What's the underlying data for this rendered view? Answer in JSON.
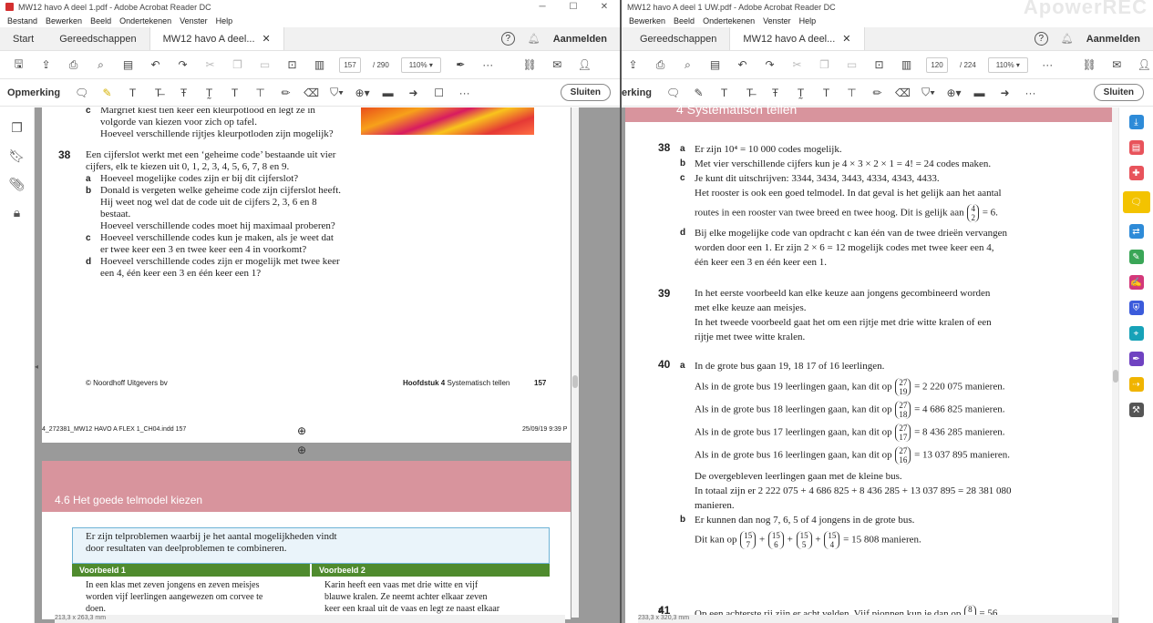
{
  "left": {
    "title": "MW12 havo A deel 1.pdf - Adobe Acrobat Reader DC",
    "menu": [
      "Bestand",
      "Bewerken",
      "Beeld",
      "Ondertekenen",
      "Venster",
      "Help"
    ],
    "tabs": {
      "start": "Start",
      "tools": "Gereedschappen",
      "doc": "MW12 havo A deel..."
    },
    "signin": "Aanmelden",
    "page_current": "157",
    "page_total": "/ 290",
    "zoom": "110%",
    "comment_title": "Opmerking",
    "close": "Sluiten",
    "page1": {
      "top_text": [
        "Margriet kiest tien keer een kleurpotlood en legt ze in",
        "volgorde van kiezen voor zich op tafel.",
        "Hoeveel verschillende rijtjes kleurpotloden zijn mogelijk?"
      ],
      "q38_num": "38",
      "q38_intro": [
        "Een cijferslot werkt met een ‘geheime code’ bestaande uit vier",
        "cijfers, elk te kiezen uit 0, 1, 2, 3, 4, 5, 6, 7, 8 en 9."
      ],
      "q38_a": "Hoeveel mogelijke codes zijn er bij dit cijferslot?",
      "q38_b": [
        "Donald is vergeten welke geheime code zijn cijferslot heeft.",
        "Hij weet nog wel dat de code uit de cijfers 2, 3, 6 en 8",
        "bestaat.",
        "Hoeveel verschillende codes moet hij maximaal proberen?"
      ],
      "q38_c": [
        "Hoeveel verschillende codes kun je maken, als je weet dat",
        "er twee keer een 3 en twee keer een 4 in voorkomt?"
      ],
      "q38_d": [
        "Hoeveel verschillende codes zijn er mogelijk met twee keer",
        "een 4, één keer een 3 en één keer een 1?"
      ],
      "footer_left": "© Noordhoff Uitgevers bv",
      "footer_chapter_bold": "Hoofdstuk 4",
      "footer_chapter": " Systematisch tellen",
      "footer_page": "157",
      "print_left": "4_272381_MW12 HAVO A FLEX 1_CH04.indd   157",
      "print_right": "25/09/19   9:39 P"
    },
    "page2": {
      "section": "4.6    Het goede telmodel kiezen",
      "intro": [
        "Er zijn telproblemen waarbij je het aantal mogelijkheden vindt",
        "door resultaten van deelproblemen te combineren."
      ],
      "v1": "Voorbeeld 1",
      "v2": "Voorbeeld 2",
      "v1_text": [
        "In een klas met zeven jongens en zeven meisjes",
        "worden vijf leerlingen aangewezen om corvee te",
        "doen."
      ],
      "v2_text": [
        "Karin heeft een vaas met drie witte en vijf",
        "blauwe kralen. Ze neemt achter elkaar zeven",
        "keer een kraal uit de vaas en legt ze naast elkaar"
      ]
    },
    "status": "213,3 x 263,3 mm"
  },
  "right": {
    "title": "MW12 havo A deel 1 UW.pdf - Adobe Acrobat Reader DC",
    "menu": [
      "Bewerken",
      "Beeld",
      "Ondertekenen",
      "Venster",
      "Help"
    ],
    "tabs": {
      "tools": "Gereedschappen",
      "doc": "MW12 havo A deel..."
    },
    "signin": "Aanmelden",
    "watermark": "ApowerREC",
    "page_current": "120",
    "page_total": "/ 224",
    "zoom": "110%",
    "comment_title": "erking",
    "close": "Sluiten",
    "section": "4   Systematisch tellen",
    "q38": {
      "num": "38",
      "a": "Er zijn 10⁴ = 10 000 codes mogelijk.",
      "b": "Met vier verschillende cijfers kun je 4 × 3 × 2 × 1 = 4! = 24 codes maken.",
      "c1": "Je kunt dit uitschrijven: 3344, 3434, 3443, 4334, 4343, 4433.",
      "c2": "Het rooster is ook een goed telmodel. In dat geval is het gelijk aan het aantal",
      "c3": "routes in een rooster van twee breed en twee hoog. Dit is gelijk aan",
      "c3_end": "= 6.",
      "d1": "Bij elke mogelijke code van opdracht c kan één van de twee drieën vervangen",
      "d2": "worden door een 1. Er zijn 2 × 6 = 12 mogelijk codes met twee keer een 4,",
      "d3": "één keer een 3 en één keer een 1."
    },
    "q39": {
      "num": "39",
      "l1": "In het eerste voorbeeld kan elke keuze aan jongens gecombineerd worden",
      "l2": "met elke keuze aan meisjes.",
      "l3": "In het tweede voorbeeld gaat het om een rijtje met drie witte kralen of een",
      "l4": "rijtje met twee witte kralen."
    },
    "q40": {
      "num": "40",
      "a": "In de grote bus gaan 19, 18 17 of 16 leerlingen.",
      "rows": [
        {
          "pre": "Als in de grote bus 19 leerlingen gaan, kan dit op",
          "n": "27",
          "k": "19",
          "post": "= 2 220 075 manieren."
        },
        {
          "pre": "Als in de grote bus 18 leerlingen gaan, kan dit op",
          "n": "27",
          "k": "18",
          "post": "= 4 686 825 manieren."
        },
        {
          "pre": "Als in de grote bus 17 leerlingen gaan, kan dit op",
          "n": "27",
          "k": "17",
          "post": "= 8 436 285 manieren."
        },
        {
          "pre": "Als in de grote bus 16 leerlingen gaan, kan dit op",
          "n": "27",
          "k": "16",
          "post": "= 13 037 895 manieren."
        }
      ],
      "rest1": "De overgebleven leerlingen gaan met de kleine bus.",
      "rest2": "In totaal zijn er 2 222 075 + 4 686 825 + 8 436 285 + 13 037 895 = 28 381 080",
      "rest3": "manieren.",
      "b": "Er kunnen dan nog 7, 6, 5 of 4 jongens in de grote bus.",
      "b2_pre": "Dit kan op",
      "b2_terms": [
        {
          "n": "15",
          "k": "7"
        },
        {
          "n": "15",
          "k": "6"
        },
        {
          "n": "15",
          "k": "5"
        },
        {
          "n": "15",
          "k": "4"
        }
      ],
      "b2_post": "= 15 808 manieren."
    },
    "q41": {
      "num": "41",
      "a": "Op een achterste rij zijn er acht velden. Vijf pionnen kun je dan op",
      "n": "8",
      "post": "= 56"
    },
    "binom_c": {
      "n": "4",
      "k": "2"
    },
    "status": "233,3 x 320,3 mm"
  }
}
